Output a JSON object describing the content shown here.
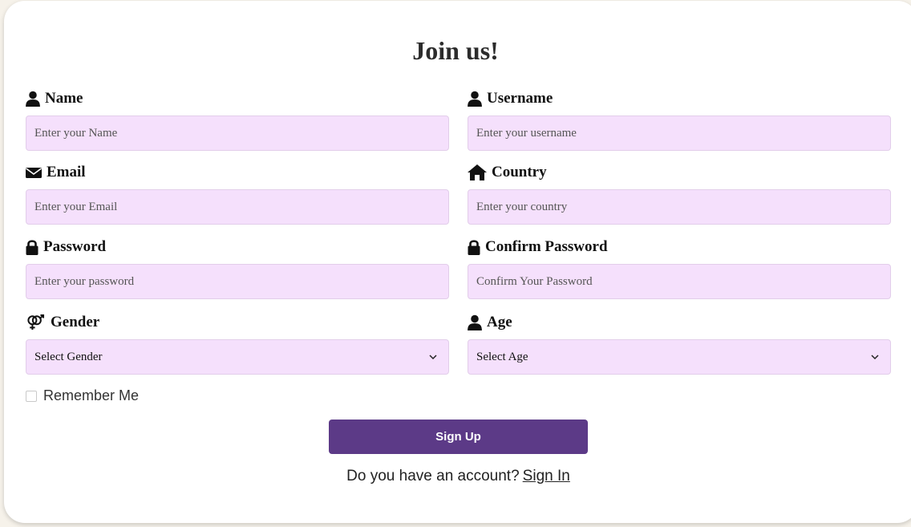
{
  "form": {
    "title": "Join us!",
    "fields": {
      "name": {
        "label": "Name",
        "placeholder": "Enter your Name",
        "icon": "user-icon"
      },
      "username": {
        "label": "Username",
        "placeholder": "Enter your username",
        "icon": "user-icon"
      },
      "email": {
        "label": "Email",
        "placeholder": "Enter your Email",
        "icon": "envelope-icon"
      },
      "country": {
        "label": "Country",
        "placeholder": "Enter your country",
        "icon": "home-icon"
      },
      "password": {
        "label": "Password",
        "placeholder": "Enter your password",
        "icon": "lock-icon"
      },
      "confirm_password": {
        "label": "Confirm Password",
        "placeholder": "Confirm Your Password",
        "icon": "lock-icon"
      },
      "gender": {
        "label": "Gender",
        "selected": "Select Gender",
        "icon": "gender-icon"
      },
      "age": {
        "label": "Age",
        "selected": "Select Age",
        "icon": "user-icon"
      }
    },
    "remember_label": "Remember Me",
    "submit_label": "Sign Up",
    "account_prompt": "Do you have an account?",
    "signin_label": "Sign In"
  },
  "colors": {
    "input_bg": "#f5e0fc",
    "button_bg": "#5c3a87"
  }
}
